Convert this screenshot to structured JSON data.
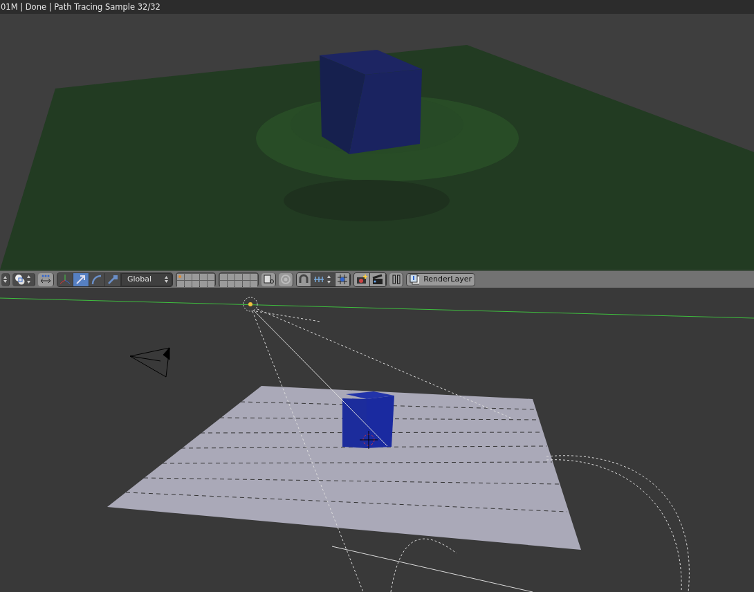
{
  "render_header": {
    "text": "01M | Done | Path Tracing Sample 32/32"
  },
  "toolbar": {
    "manipulators": [
      {
        "kind": "axes",
        "on": false
      },
      {
        "kind": "translate",
        "on": true
      },
      {
        "kind": "rotate",
        "on": false
      },
      {
        "kind": "scale",
        "on": false
      }
    ],
    "orientation": "Global",
    "layer_groups": [
      {
        "layers": [
          {
            "occupied": true
          },
          {
            "occupied": false
          },
          {
            "occupied": false
          },
          {
            "occupied": false
          },
          {
            "occupied": false
          },
          {
            "occupied": false
          },
          {
            "occupied": false
          },
          {
            "occupied": false
          },
          {
            "occupied": false
          },
          {
            "occupied": false
          }
        ]
      },
      {
        "layers": [
          {
            "occupied": false
          },
          {
            "occupied": false
          },
          {
            "occupied": false
          },
          {
            "occupied": false
          },
          {
            "occupied": false
          },
          {
            "occupied": false
          },
          {
            "occupied": false
          },
          {
            "occupied": false
          },
          {
            "occupied": false
          },
          {
            "occupied": false
          }
        ]
      }
    ],
    "render_layer": "RenderLayer"
  }
}
